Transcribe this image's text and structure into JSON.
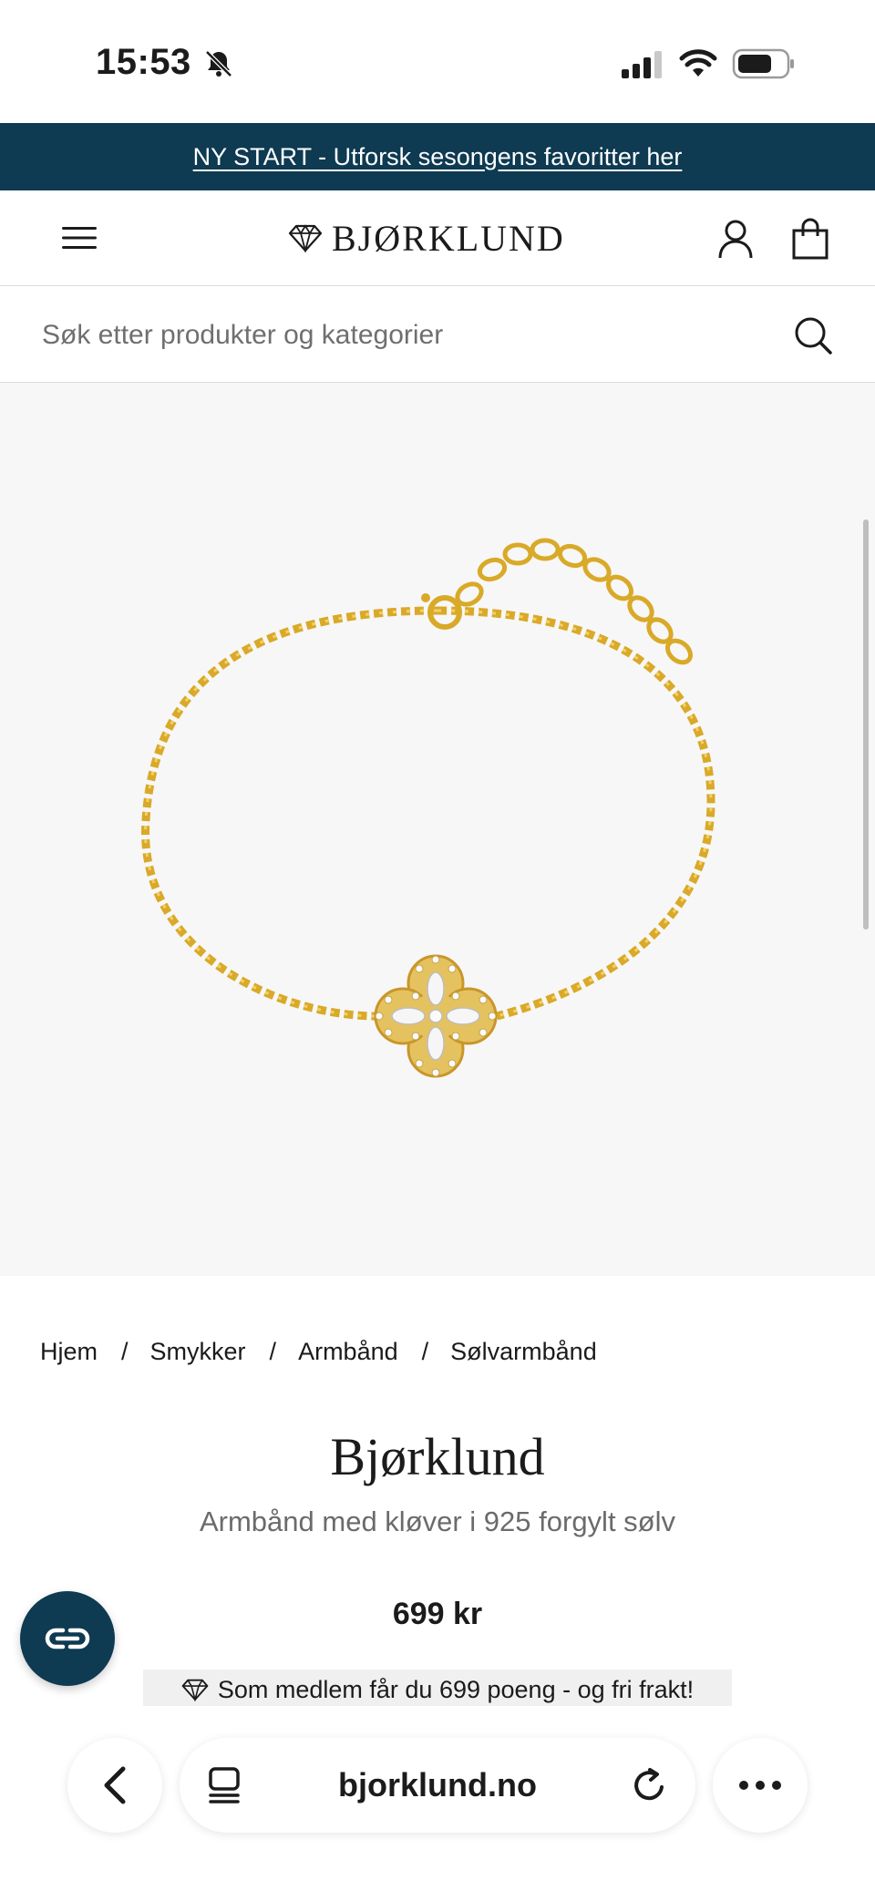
{
  "status_bar": {
    "time": "15:53"
  },
  "promo": {
    "text": "NY START - Utforsk sesongens favoritter her"
  },
  "header": {
    "logo_text": "BJØRKLUND"
  },
  "search": {
    "placeholder": "Søk etter produkter og kategorier"
  },
  "breadcrumb": {
    "items": [
      "Hjem",
      "Smykker",
      "Armbånd",
      "Sølvarmbånd"
    ],
    "separator": "/"
  },
  "product": {
    "brand": "Bjørklund",
    "title": "Armbånd med kløver i 925 forgylt sølv",
    "price": "699 kr",
    "member_note": "Som medlem får du 699 poeng - og fri frakt!"
  },
  "browser": {
    "domain": "bjorklund.no"
  },
  "colors": {
    "brand_navy": "#0e3a52",
    "gold": "#d9a928"
  },
  "icons": [
    "bell-slash-icon",
    "signal-icon",
    "wifi-icon",
    "battery-icon",
    "menu-icon",
    "diamond-logo-icon",
    "user-icon",
    "shopping-bag-icon",
    "search-icon",
    "chat-icon",
    "back-icon",
    "tabs-icon",
    "reload-icon",
    "more-icon"
  ]
}
